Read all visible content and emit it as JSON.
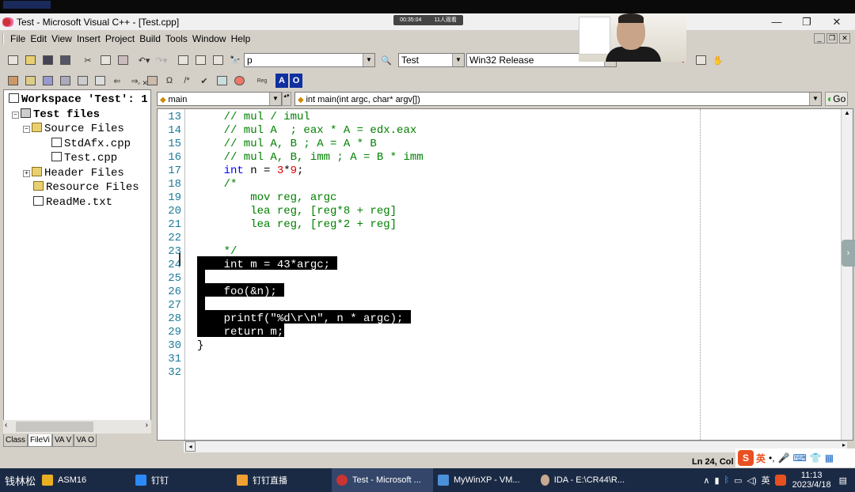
{
  "window": {
    "title": "Test - Microsoft Visual C++ - [Test.cpp]",
    "rec_time": "00:35:04",
    "rec_viewers": "11人观看",
    "ctl_min": "—",
    "ctl_max": "❐",
    "ctl_close": "✕"
  },
  "menu": {
    "items": [
      "File",
      "Edit",
      "View",
      "Insert",
      "Project",
      "Build",
      "Tools",
      "Window",
      "Help"
    ]
  },
  "mdi": {
    "min": "_",
    "restore": "❐",
    "close": "✕"
  },
  "toolbar": {
    "find_combo": "p",
    "config_combo": "Test",
    "platform_combo": "Win32 Release",
    "reg_label": "Reg",
    "a_label": "A",
    "o_label": "O"
  },
  "workspace": {
    "title": "Workspace 'Test': 1",
    "project": "Test files",
    "source_folder": "Source Files",
    "file1": "StdAfx.cpp",
    "file2": "Test.cpp",
    "header_folder": "Header Files",
    "resource_folder": "Resource Files",
    "readme": "ReadMe.txt",
    "tabs": [
      "Class",
      "FileVi",
      "VA V",
      "VA O"
    ]
  },
  "editor": {
    "scope_combo": "main",
    "function_combo": "int main(int argc, char* argv[])",
    "go_label": "Go",
    "line_numbers": [
      "13",
      "14",
      "15",
      "16",
      "17",
      "18",
      "19",
      "20",
      "21",
      "22",
      "23",
      "24",
      "25",
      "26",
      "27",
      "28",
      "29",
      "30",
      "31",
      "32"
    ],
    "lines": {
      "l13": "    // mul / imul",
      "l14": "    // mul A  ; eax * A = edx.eax",
      "l15": "    // mul A, B ; A = A * B",
      "l16": "    // mul A, B, imm ; A = B * imm",
      "l17_kw": "int",
      "l17_a": " n = ",
      "l17_n1": "3",
      "l17_op": "*",
      "l17_n2": "9",
      "l17_b": ";",
      "l18": "    /*",
      "l19": "        mov reg, argc",
      "l20": "        lea reg, [reg*8 + reg]",
      "l21": "        lea reg, [reg*2 + reg]",
      "l23": "    */",
      "l24": "    int m = 43*argc;",
      "l26": "    foo(&n);",
      "l28": "    printf(\"%d\\r\\n\", n * argc);",
      "l29": "    return m;",
      "l30": "}"
    }
  },
  "status": {
    "position": "Ln 24, Col"
  },
  "ime": {
    "logo": "S",
    "lang": "英",
    "punct": "•,"
  },
  "taskbar": {
    "user": "钱林松",
    "items": [
      "ASM16",
      "钉钉",
      "钉钉直播",
      "Test - Microsoft ...",
      "MyWinXP - VM...",
      "IDA - E:\\CR44\\R..."
    ],
    "tray_lang": "英",
    "clock_time": "11:13",
    "clock_date": "2023/4/18"
  }
}
